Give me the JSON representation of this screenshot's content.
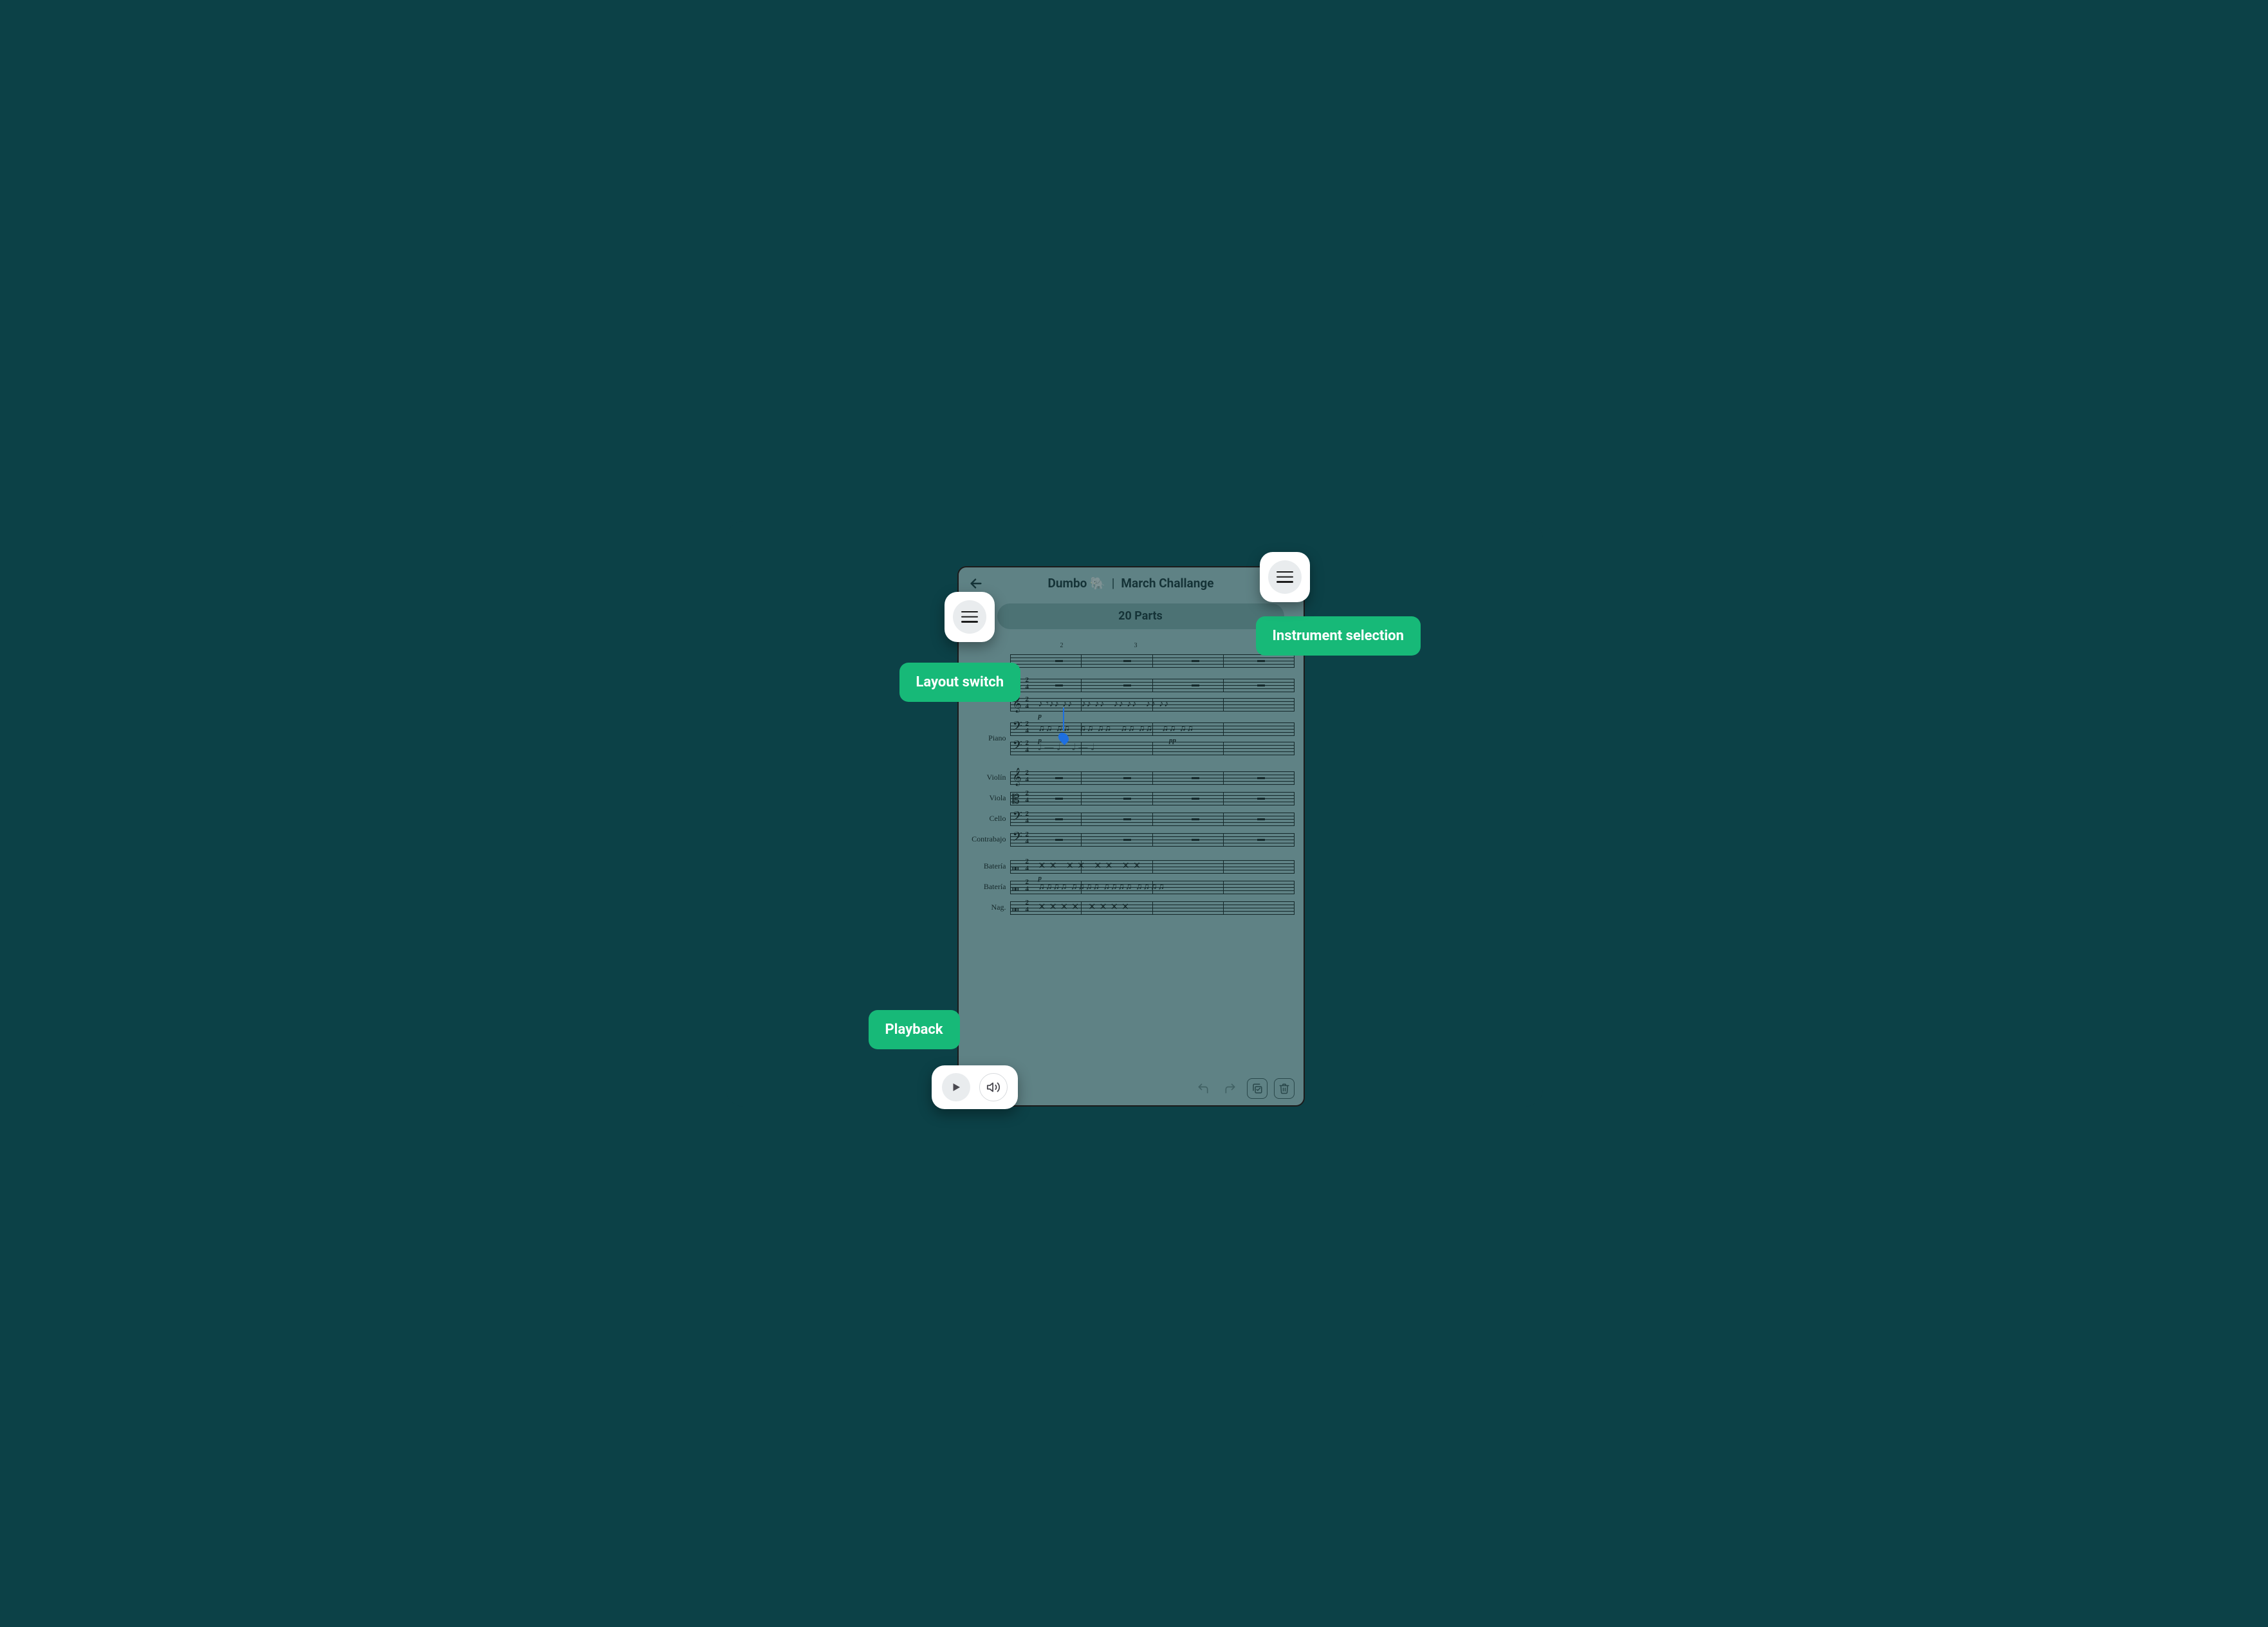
{
  "header": {
    "title_left": "Dumbo 🐘",
    "title_right": "March Challange",
    "separator": "|"
  },
  "parts_pill": "20 Parts",
  "measure_numbers": [
    "2",
    "3"
  ],
  "instruments": [
    "",
    "Piano",
    "Piano",
    "Violín",
    "Viola",
    "Cello",
    "Contrabajo",
    "Batería",
    "Batería",
    "Nag."
  ],
  "time_signature": {
    "top": "2",
    "bottom": "4"
  },
  "dynamics": {
    "p": "p",
    "pp": "pp"
  },
  "callouts": {
    "layout_switch": "Layout switch",
    "instrument_selection": "Instrument selection",
    "playback": "Playback"
  },
  "icons": {
    "back": "arrow-left",
    "menu": "hamburger",
    "play": "play",
    "volume": "volume",
    "undo": "undo",
    "redo": "redo",
    "copy": "copy-check",
    "trash": "trash"
  },
  "colors": {
    "background": "#0c4147",
    "accent_green": "#17b978",
    "cursor_blue": "#1e6fe0"
  }
}
